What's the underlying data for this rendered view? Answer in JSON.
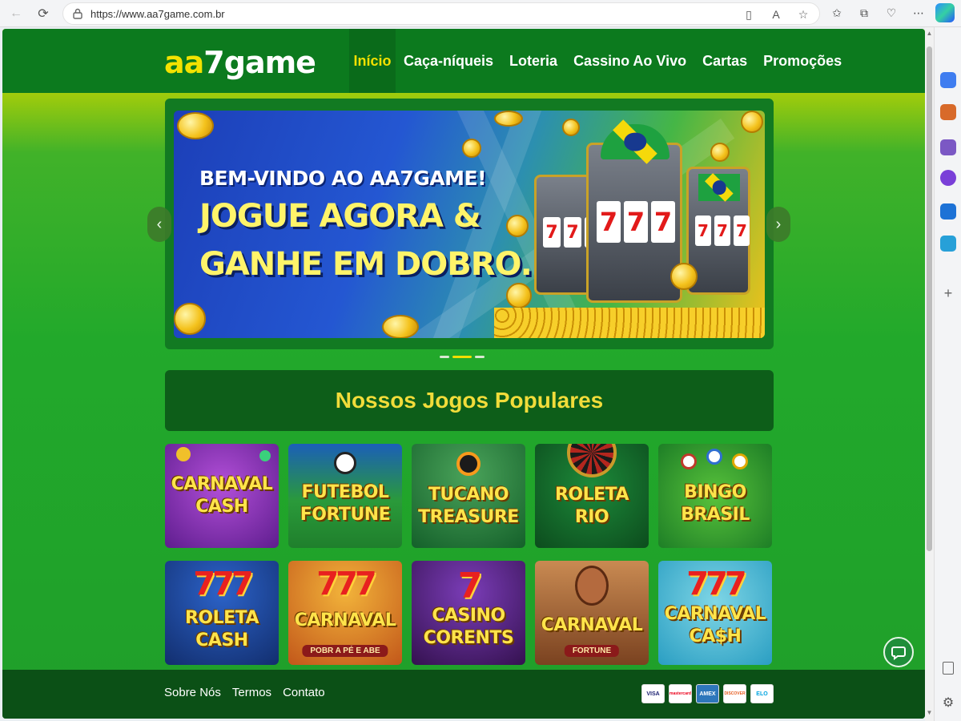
{
  "browser": {
    "url": "https://www.aa7game.com.br"
  },
  "site": {
    "logo_main": "aa7game",
    "nav": [
      "Início",
      "Caça-níqueis",
      "Loteria",
      "Cassino Ao Vivo",
      "Cartas",
      "Promoções"
    ],
    "hero": {
      "line1": "BEM-VINDO AO AA7GAME!",
      "line2": "JOGUE AGORA &",
      "line3": "GANHE EM DOBRO.",
      "reel": "777",
      "prev": "‹",
      "next": "›",
      "active_slide": 2
    },
    "section_title": "Nossos Jogos Populares",
    "games": [
      {
        "title": "CARNAVAL CASH",
        "sub": ""
      },
      {
        "title": "FUTEBOL FORTUNE",
        "sub": ""
      },
      {
        "title": "TUCANO TREASURE",
        "sub": ""
      },
      {
        "title": "ROLETA RIO",
        "sub": ""
      },
      {
        "title": "BINGO BRASIL",
        "sub": ""
      },
      {
        "title": "ROLETA CASH",
        "sub": ""
      },
      {
        "title": "CARNAVAL",
        "sub": "POBR A PÉ E ABE"
      },
      {
        "title": "CASINO CORENTS",
        "sub": ""
      },
      {
        "title": "CARNAVAL",
        "sub": "FORTUNE"
      },
      {
        "title": "CARNAVAL CA$H",
        "sub": ""
      }
    ],
    "footer": {
      "links": [
        "Sobre Nós",
        "Termos",
        "Contato"
      ],
      "payments": [
        "VISA",
        "mastercard",
        "AMEX",
        "DISCOVER",
        "ELO"
      ]
    }
  },
  "colors": {
    "header_green": "#0c7a1e",
    "accent_yellow": "#f4e000",
    "footer_green": "#0b5016"
  }
}
